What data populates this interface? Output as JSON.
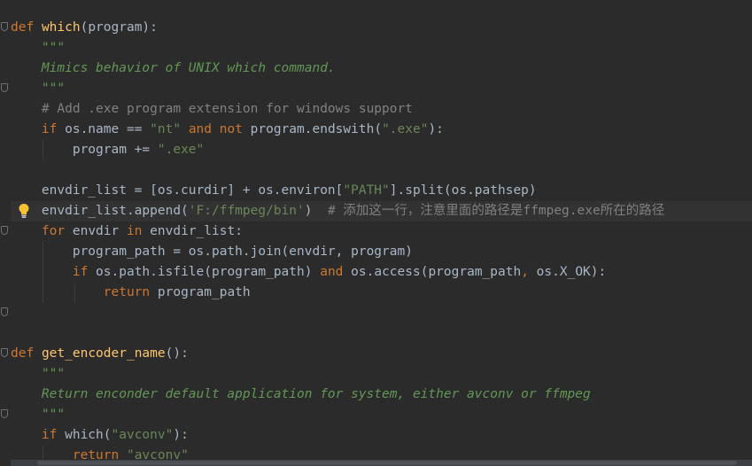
{
  "editor": {
    "lines": [
      {
        "text": "def which(program):"
      },
      {
        "text": "    \"\"\""
      },
      {
        "text": "    Mimics behavior of UNIX which command."
      },
      {
        "text": "    \"\"\""
      },
      {
        "text": "    # Add .exe program extension for windows support"
      },
      {
        "text": "    if os.name == \"nt\" and not program.endswith(\".exe\"):"
      },
      {
        "text": "        program += \".exe\""
      },
      {
        "text": ""
      },
      {
        "text": "    envdir_list = [os.curdir] + os.environ[\"PATH\"].split(os.pathsep)"
      },
      {
        "text": "    envdir_list.append('F:/ffmpeg/bin')  # 添加这一行，注意里面的路径是ffmpeg.exe所在的路径"
      },
      {
        "text": "    for envdir in envdir_list:"
      },
      {
        "text": "        program_path = os.path.join(envdir, program)"
      },
      {
        "text": "        if os.path.isfile(program_path) and os.access(program_path, os.X_OK):"
      },
      {
        "text": "            return program_path"
      },
      {
        "text": ""
      },
      {
        "text": ""
      },
      {
        "text": "def get_encoder_name():"
      },
      {
        "text": "    \"\"\""
      },
      {
        "text": "    Return enconder default application for system, either avconv or ffmpeg"
      },
      {
        "text": "    \"\"\""
      },
      {
        "text": "    if which(\"avconv\"):"
      },
      {
        "text": "        return \"avconv\""
      }
    ],
    "tokens": {
      "kw_def": "def",
      "fn_which": "which",
      "fn_get_encoder_name": "get_encoder_name",
      "doc_which": "Mimics behavior of UNIX which command.",
      "doc_encoder": "Return enconder default application for system, either avconv or ffmpeg",
      "comment_exe": "# Add .exe program extension for windows support",
      "comment_cn": "# 添加这一行，注意里面的路径是ffmpeg.exe所在的路径",
      "str_nt": "\"nt\"",
      "str_exe": "\".exe\"",
      "str_path": "\"PATH\"",
      "str_ffmpeg_bin": "'F:/ffmpeg/bin'",
      "str_avconv": "\"avconv\""
    }
  },
  "colors": {
    "background": "#2b2b2b",
    "keyword": "#cc7832",
    "function": "#ffc66d",
    "string": "#6a8759",
    "docstring": "#629755",
    "comment": "#808080",
    "text": "#a9b7c6",
    "current_line": "#323232"
  },
  "icons": {
    "intention": "lightbulb-icon",
    "fold": "fold-marker-icon"
  }
}
